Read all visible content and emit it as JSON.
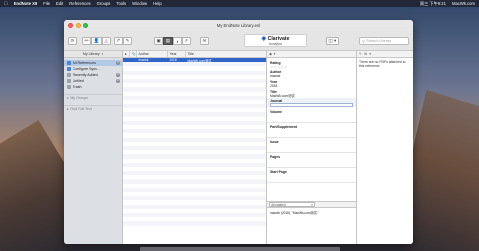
{
  "menubar": {
    "app_name": "EndNote X9",
    "items": [
      "File",
      "Edit",
      "References",
      "Groups",
      "Tools",
      "Window",
      "Help"
    ],
    "clock": "周三 下午9:21",
    "site": "MacWk.com"
  },
  "window": {
    "title": "My EndNote Library.enl"
  },
  "toolbar": {
    "brand_name": "Clarivate",
    "brand_sub": "Analytics",
    "search_placeholder": "Search Library"
  },
  "sidebar": {
    "header": "My Library",
    "items": [
      {
        "label": "All References",
        "count": "1",
        "icon": "book-icon"
      },
      {
        "label": "Configure Sync...",
        "count": "",
        "icon": "sync-icon"
      },
      {
        "label": "Recently Added",
        "count": "1",
        "icon": "clock-icon"
      },
      {
        "label": "Unfiled",
        "count": "1",
        "icon": "doc-icon"
      },
      {
        "label": "Trash",
        "count": "",
        "icon": "trash-icon"
      }
    ],
    "groups": [
      "My Groups",
      "Find Full Text"
    ]
  },
  "reflist": {
    "columns": [
      "●",
      "📎",
      "Author",
      "Year",
      "Title"
    ],
    "rows": [
      {
        "author": "macwk",
        "year": "2018",
        "title": "MacWk.com测试"
      }
    ]
  },
  "detail": {
    "rating_label": "Rating",
    "rating_stars": "☆☆☆☆☆",
    "fields": [
      {
        "label": "Author",
        "value": "macwk"
      },
      {
        "label": "Year",
        "value": "2018"
      },
      {
        "label": "Title",
        "value": "MacWk.com测试"
      }
    ],
    "journal_label": "Journal",
    "empty_fields": [
      "Volume",
      "Part/Supplement",
      "Issue",
      "Pages",
      "Start Page"
    ],
    "annotation_option": "Annotated",
    "annotation_text": "macwk (2018). \"MacWk.com测试.\""
  },
  "pdf": {
    "message": "There are no PDFs attached to this reference"
  }
}
